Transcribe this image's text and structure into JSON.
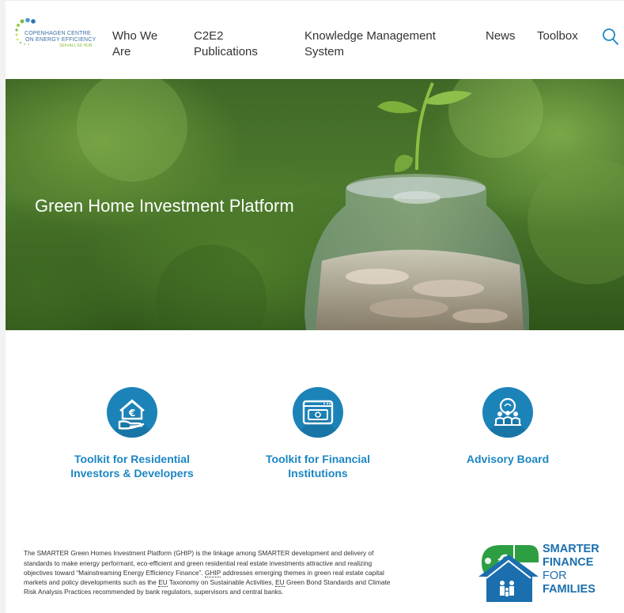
{
  "logo": {
    "line1": "COPENHAGEN CENTRE",
    "line2": "ON ENERGY EFFICIENCY",
    "line3": "SEforALL EE HUB"
  },
  "nav": {
    "who_we_are": [
      "Who We",
      "Are"
    ],
    "publications": [
      "C2E2",
      "Publications"
    ],
    "kms": [
      "Knowledge Management",
      "System"
    ],
    "news": "News",
    "toolbox": "Toolbox"
  },
  "hero": {
    "title": "Green Home Investment Platform"
  },
  "tools": [
    {
      "lines": [
        "Toolkit for Residential",
        "Investors & Developers"
      ],
      "icon": "house-euro-hand-icon"
    },
    {
      "lines": [
        "Toolkit for Financial",
        "Institutions"
      ],
      "icon": "banknote-window-icon"
    },
    {
      "lines": [
        "Advisory Board"
      ],
      "icon": "advisory-group-icon"
    }
  ],
  "description": {
    "part1": "The SMARTER Green Homes Investment Platform (GHIP) is the linkage among SMARTER development and delivery of standards to make energy performant, eco-efficient and green residential real estate investments attractive and realizing objectives toward “Mainstreaming Energy Efficiency Finance”.",
    "abbr1": "GHIP",
    "part2": "addresses emerging themes in green real estate capital markets and policy developments such as the",
    "abbr2": "EU",
    "part3": "Taxonomy on Sustainable Activities,",
    "abbr3": "EU",
    "part4": "Green Bond Standards and Climate Risk Analysis Practices recommended by bank regulators, supervisors and central banks."
  },
  "sff_logo": {
    "l1": "SMARTER",
    "l2": "FINANCE",
    "l3": "FOR",
    "l4": "FAMILIES"
  },
  "colors": {
    "accent_blue": "#1c86c3",
    "icon_blue": "#1c83b8",
    "logo_green": "#2e9e43"
  }
}
